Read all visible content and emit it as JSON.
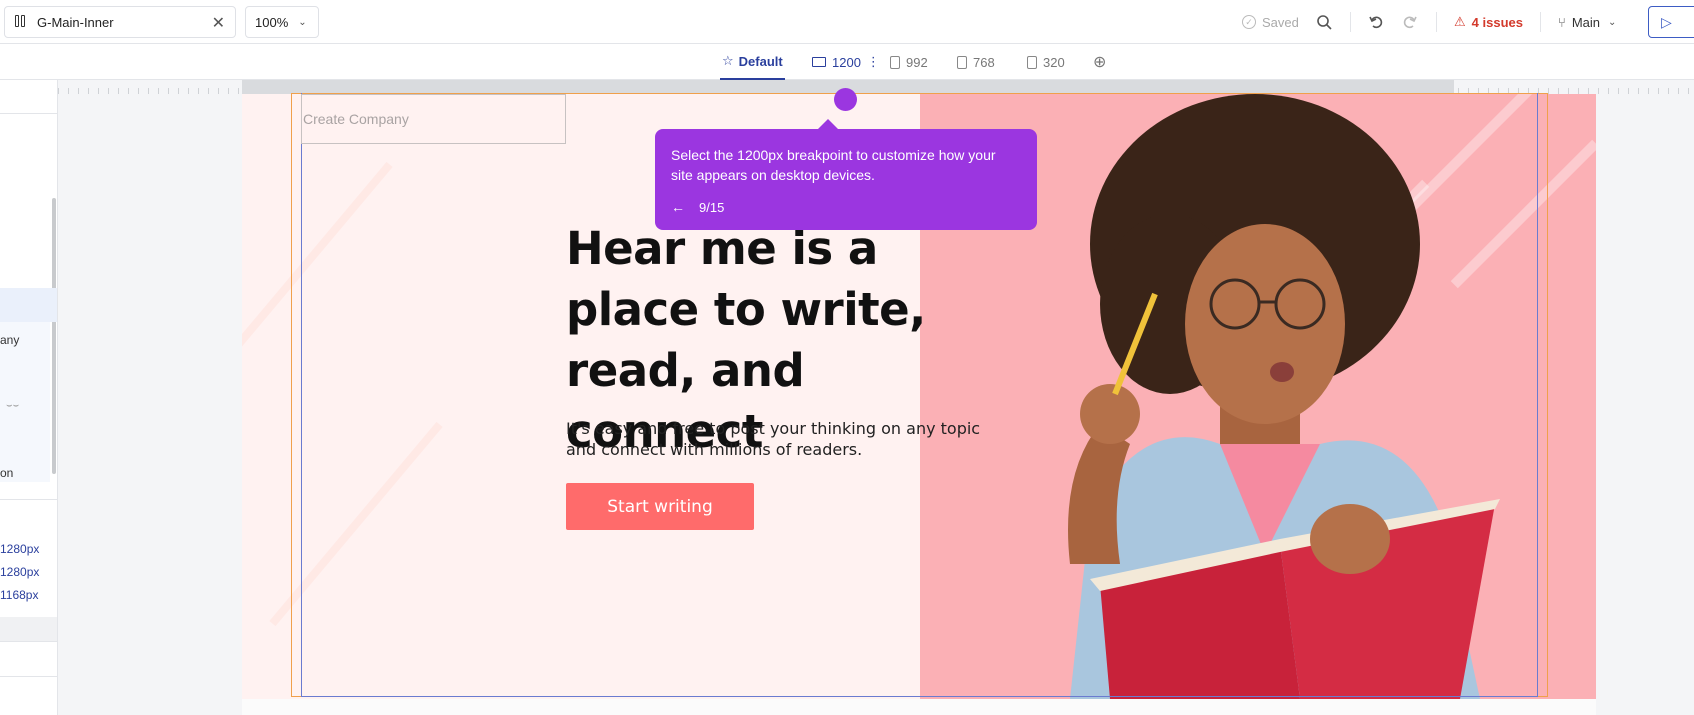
{
  "topbar": {
    "tab_label": "G-Main-Inner",
    "tab_close": "✕",
    "zoom_value": "100%",
    "saved_label": "Saved",
    "issues_label": "4 issues",
    "branch_label": "Main",
    "undo_icon": "undo-icon",
    "redo_icon": "redo-icon",
    "search_icon": "search-icon"
  },
  "breakpoints": {
    "default_label": "Default",
    "b1200": "1200",
    "b992": "992",
    "b768": "768",
    "b320": "320"
  },
  "left_panel": {
    "frag1": "any",
    "frag2": "on",
    "px": [
      "1280px",
      "1280px",
      "1168px"
    ]
  },
  "page": {
    "company_placeholder": "Create Company",
    "headline": "Hear me is a place to write, read, and connect",
    "subtext": "It's easy and free to post your thinking on any topic and connect with millions of readers.",
    "cta_label": "Start writing"
  },
  "tooltip": {
    "message": "Select the 1200px breakpoint to customize how your site appears on desktop devices.",
    "step": "9/15"
  },
  "colors": {
    "accent": "#2a3f9d",
    "tooltip": "#9b36e0",
    "cta": "#ff6b6b",
    "hero_pink": "#fbb0b5",
    "issues_red": "#d33a2c"
  }
}
